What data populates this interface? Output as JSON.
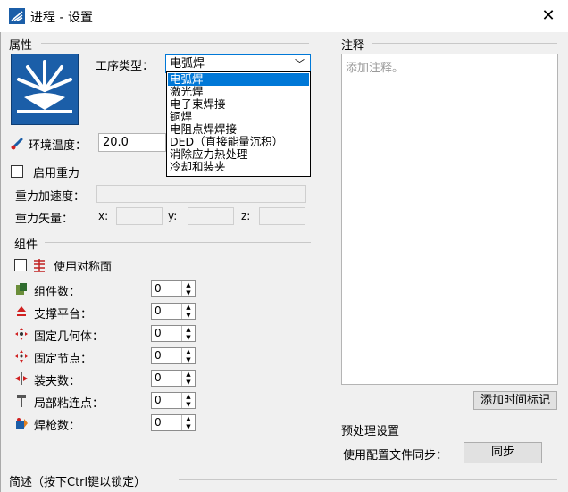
{
  "window": {
    "title": "进程 - 设置",
    "close_glyph": "✕"
  },
  "properties": {
    "section_label": "属性",
    "process_type_label": "工序类型：",
    "process_type_value": "电弧焊",
    "process_type_options": [
      "电弧焊",
      "激光焊",
      "电子束焊接",
      "铜焊",
      "电阻点焊焊接",
      "DED（直接能量沉积）",
      "消除应力热处理",
      "冷却和装夹"
    ],
    "ambient_temp_label": "环境温度：",
    "ambient_temp_value": "20.0"
  },
  "gravity": {
    "enable_label": "启用重力",
    "accel_label": "重力加速度：",
    "vector_label": "重力矢量：",
    "x_label": "x:",
    "y_label": "y:",
    "z_label": "z:"
  },
  "components": {
    "section_label": "组件",
    "symmetry_label": "使用对称面",
    "rows": [
      {
        "label": "组件数：",
        "value": "0",
        "icon": "components-icon"
      },
      {
        "label": "支撑平台：",
        "value": "0",
        "icon": "support-platform-icon"
      },
      {
        "label": "固定几何体：",
        "value": "0",
        "icon": "fixed-geometry-icon"
      },
      {
        "label": "固定节点：",
        "value": "0",
        "icon": "fixed-node-icon"
      },
      {
        "label": "装夹数：",
        "value": "0",
        "icon": "clamp-icon"
      },
      {
        "label": "局部粘连点：",
        "value": "0",
        "icon": "tack-point-icon"
      },
      {
        "label": "焊枪数：",
        "value": "0",
        "icon": "welding-torch-icon"
      }
    ]
  },
  "notes": {
    "section_label": "注释",
    "placeholder": "添加注释。",
    "add_timestamp_button": "添加时间标记"
  },
  "preprocess": {
    "section_label": "预处理设置",
    "sync_label": "使用配置文件同步：",
    "sync_button": "同步"
  },
  "description": {
    "section_label": "简述（按下Ctrl键以锁定）"
  },
  "colors": {
    "selection": "#0078d7",
    "icon_blue": "#1b5ea8"
  }
}
